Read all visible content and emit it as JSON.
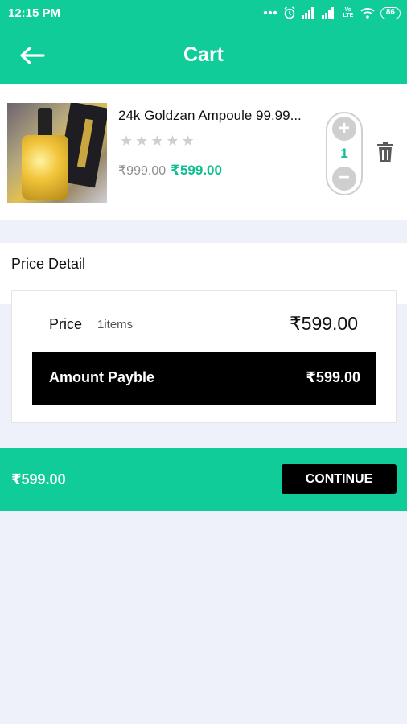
{
  "status_bar": {
    "time": "12:15 PM",
    "battery": "86",
    "icons": [
      "notification-dots-icon",
      "alarm-icon",
      "signal-icon",
      "signal-icon",
      "volte-icon",
      "wifi-icon",
      "battery-icon"
    ],
    "volte_label": "Vo LTE"
  },
  "app_bar": {
    "title": "Cart",
    "back_icon": "arrow-left-icon"
  },
  "cart": {
    "items": [
      {
        "name": "24k Goldzan Ampoule 99.99...",
        "rating": 0,
        "rating_max": 5,
        "price_original": "₹999.00",
        "price_current": "₹599.00",
        "quantity": "1",
        "plus_label": "+",
        "minus_label": "−"
      }
    ]
  },
  "price_detail": {
    "title": "Price Detail",
    "price_label": "Price",
    "items_count": "1items",
    "price_value": "₹599.00",
    "amount_label": "Amount Payble",
    "amount_value": "₹599.00"
  },
  "bottom_bar": {
    "total": "₹599.00",
    "continue_label": "CONTINUE"
  },
  "colors": {
    "accent": "#0fcc98",
    "price_green": "#0fbf8f",
    "background": "#eef0fa",
    "dark": "#000000"
  }
}
